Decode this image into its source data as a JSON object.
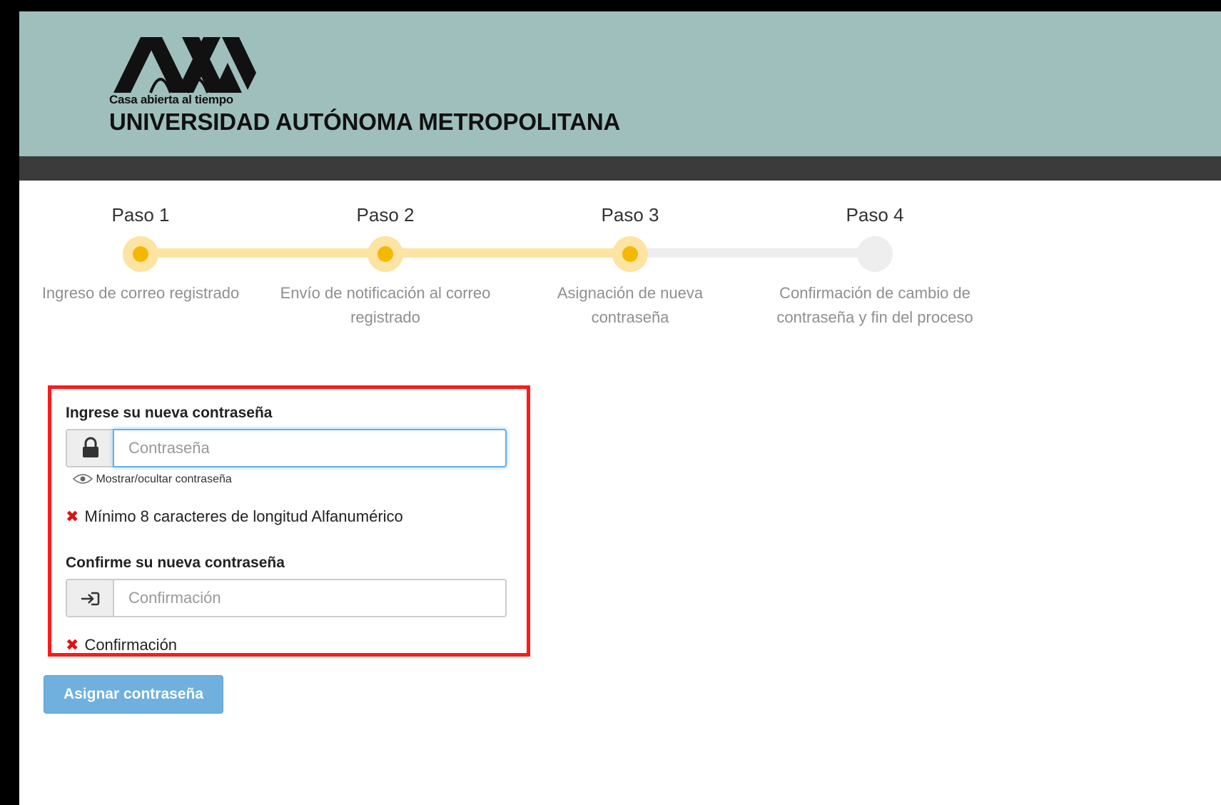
{
  "header": {
    "logo_icon": "uam-logo-icon",
    "tagline": "Casa abierta al tiempo",
    "university_name": "UNIVERSIDAD AUTÓNOMA METROPOLITANA",
    "header_color": "#9fbfbc",
    "bar_color": "#3b3b3b"
  },
  "stepper": {
    "active_color": "#f5b800",
    "steps": [
      {
        "title": "Paso 1",
        "description": "Ingreso de correo registrado",
        "status": "completed"
      },
      {
        "title": "Paso 2",
        "description": "Envío de notificación al correo registrado",
        "status": "completed"
      },
      {
        "title": "Paso 3",
        "description": "Asignación de nueva contraseña",
        "status": "current"
      },
      {
        "title": "Paso 4",
        "description": "Confirmación de cambio de contraseña y fin del proceso",
        "status": "pending"
      }
    ]
  },
  "form": {
    "password": {
      "label": "Ingrese su nueva contraseña",
      "icon": "lock-icon",
      "placeholder": "Contraseña",
      "value": ""
    },
    "show_toggle": {
      "icon": "eye-icon",
      "label": "Mostrar/ocultar contraseña"
    },
    "password_rule": {
      "icon": "x-mark-icon",
      "text": "Mínimo 8 caracteres de longitud Alfanumérico"
    },
    "confirm": {
      "label": "Confirme su nueva contraseña",
      "icon": "sign-in-icon",
      "placeholder": "Confirmación",
      "value": ""
    },
    "confirm_rule": {
      "icon": "x-mark-icon",
      "text": "Confirmación"
    },
    "error_color": "#e01010",
    "highlight_border_color": "#ff1a1a"
  },
  "submit": {
    "label": "Asignar contraseña",
    "color": "#6fb0de"
  }
}
